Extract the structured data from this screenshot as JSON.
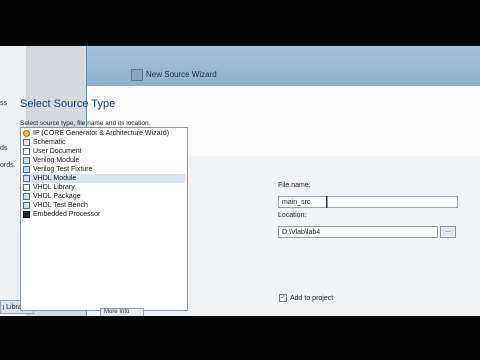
{
  "background_window": {
    "text_fragments": [
      "ss",
      "ds",
      "ords."
    ],
    "libraries_tab": "Libraries"
  },
  "wizard": {
    "title": "New Source Wizard",
    "section_title": "Select Source Type",
    "instruction": "Select source type, file name and its location.",
    "source_types": [
      {
        "label": "IP (CORE Generator & Architecture Wizard)",
        "icon": "ip-core-icon"
      },
      {
        "label": "Schematic",
        "icon": "schematic-icon"
      },
      {
        "label": "User Document",
        "icon": "document-icon"
      },
      {
        "label": "Verilog Module",
        "icon": "verilog-module-icon"
      },
      {
        "label": "Verilog Test Fixture",
        "icon": "verilog-test-fixture-icon"
      },
      {
        "label": "VHDL Module",
        "icon": "vhdl-module-icon"
      },
      {
        "label": "VHDL Library",
        "icon": "vhdl-library-icon"
      },
      {
        "label": "VHDL Package",
        "icon": "vhdl-package-icon"
      },
      {
        "label": "VHDL Test Bench",
        "icon": "vhdl-test-bench-icon"
      },
      {
        "label": "Embedded Processor",
        "icon": "embedded-processor-icon"
      }
    ],
    "selected_index": 5,
    "file_name_label": "File name:",
    "file_name_value": "main_src",
    "location_label": "Location:",
    "location_value": "D:\\Vlab\\lab4",
    "browse_label": "...",
    "add_to_project_label": "Add to project",
    "add_to_project_checked": true,
    "more_info_label": "More Info"
  },
  "colors": {
    "section_title": "#1b3f73",
    "titlebar": "#8fb0cc",
    "selection": "#d8e3ef"
  }
}
